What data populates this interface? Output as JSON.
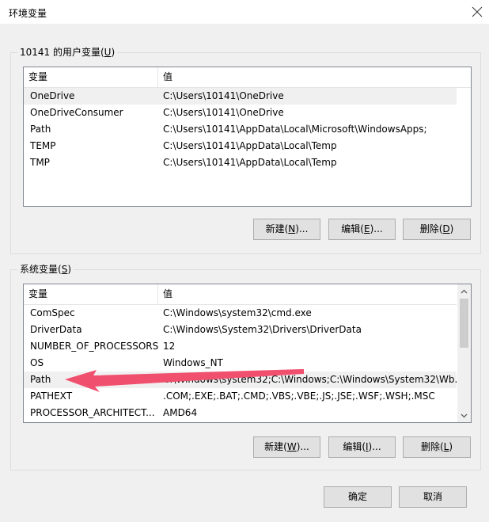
{
  "window": {
    "title": "环境变量"
  },
  "user_vars": {
    "group_label_prefix": "10141 的用户变量(",
    "group_label_key": "U",
    "group_label_suffix": ")",
    "col_var": "变量",
    "col_val": "值",
    "rows": [
      {
        "name": "OneDrive",
        "value": "C:\\Users\\10141\\OneDrive"
      },
      {
        "name": "OneDriveConsumer",
        "value": "C:\\Users\\10141\\OneDrive"
      },
      {
        "name": "Path",
        "value": "C:\\Users\\10141\\AppData\\Local\\Microsoft\\WindowsApps;"
      },
      {
        "name": "TEMP",
        "value": "C:\\Users\\10141\\AppData\\Local\\Temp"
      },
      {
        "name": "TMP",
        "value": "C:\\Users\\10141\\AppData\\Local\\Temp"
      }
    ],
    "buttons": {
      "new_pre": "新建(",
      "new_key": "N",
      "new_post": ")...",
      "edit_pre": "编辑(",
      "edit_key": "E",
      "edit_post": ")...",
      "delete_pre": "删除(",
      "delete_key": "D",
      "delete_post": ")"
    }
  },
  "system_vars": {
    "group_label_prefix": "系统变量(",
    "group_label_key": "S",
    "group_label_suffix": ")",
    "col_var": "变量",
    "col_val": "值",
    "rows": [
      {
        "name": "ComSpec",
        "value": "C:\\Windows\\system32\\cmd.exe"
      },
      {
        "name": "DriverData",
        "value": "C:\\Windows\\System32\\Drivers\\DriverData"
      },
      {
        "name": "NUMBER_OF_PROCESSORS",
        "value": "12"
      },
      {
        "name": "OS",
        "value": "Windows_NT"
      },
      {
        "name": "Path",
        "value": "C:\\Windows\\system32;C:\\Windows;C:\\Windows\\System32\\Wb..."
      },
      {
        "name": "PATHEXT",
        "value": ".COM;.EXE;.BAT;.CMD;.VBS;.VBE;.JS;.JSE;.WSF;.WSH;.MSC"
      },
      {
        "name": "PROCESSOR_ARCHITECT...",
        "value": "AMD64"
      }
    ],
    "buttons": {
      "new_pre": "新建(",
      "new_key": "W",
      "new_post": ")...",
      "edit_pre": "编辑(",
      "edit_key": "I",
      "edit_post": ")...",
      "delete_pre": "删除(",
      "delete_key": "L",
      "delete_post": ")"
    }
  },
  "footer": {
    "ok_label": "确定",
    "cancel_label": "取消"
  },
  "colors": {
    "annotation_arrow": "#f0506e",
    "selection": "#f0f0f0"
  }
}
